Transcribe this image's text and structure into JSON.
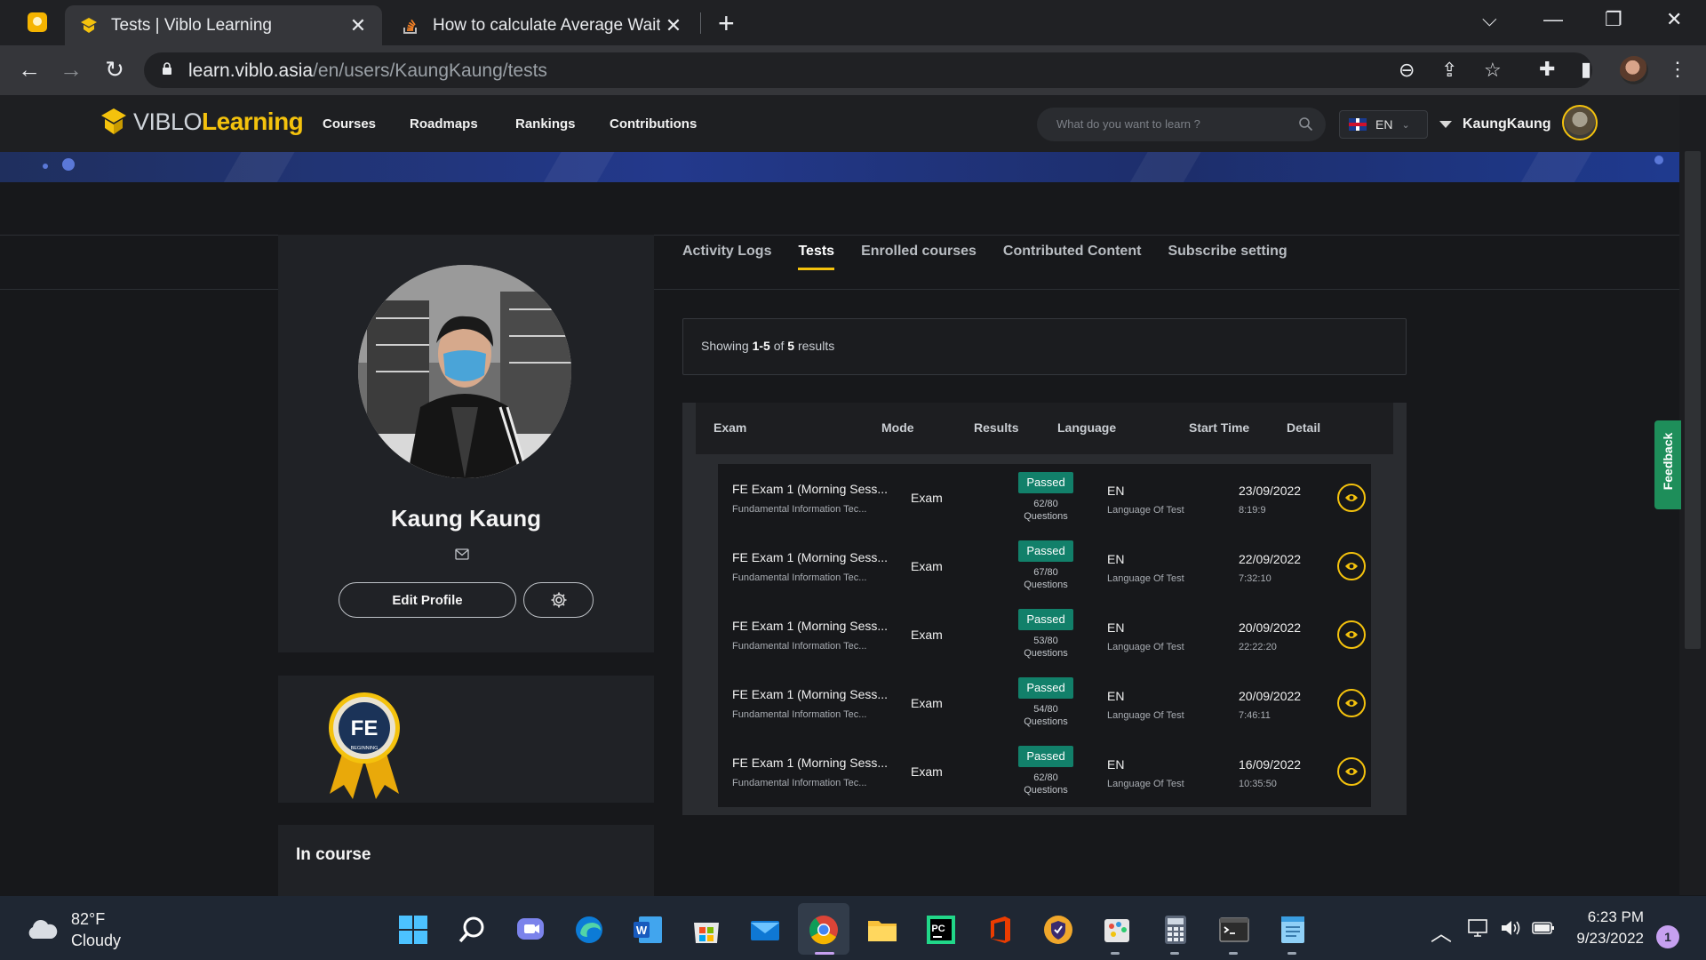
{
  "browser": {
    "tabs": [
      {
        "title": "Tests | Viblo Learning",
        "active": true,
        "favicon": "viblo-logo-icon"
      },
      {
        "title": "How to calculate Average Waiting",
        "active": false,
        "favicon": "stackoverflow-icon"
      }
    ],
    "url_host": "learn.viblo.asia",
    "url_path": "/en/users/KaungKaung/tests"
  },
  "site": {
    "logo_viblo": "VIBLO",
    "logo_learning": "Learning",
    "nav": [
      "Courses",
      "Roadmaps",
      "Rankings",
      "Contributions"
    ],
    "search_placeholder": "What do you want to learn ?",
    "language": "EN",
    "username": "KaungKaung",
    "brand_color": "#f4c20d"
  },
  "profile": {
    "name": "Kaung Kaung",
    "edit_label": "Edit Profile",
    "badge_text": "FE",
    "badge_subtext": "BEGINNING",
    "in_course_title": "In course"
  },
  "profile_tabs": [
    "Activity Logs",
    "Tests",
    "Enrolled courses",
    "Contributed Content",
    "Subscribe setting"
  ],
  "active_tab": "Tests",
  "results": {
    "prefix": "Showing ",
    "range": "1-5",
    "of": " of ",
    "total": "5",
    "suffix": " results"
  },
  "table": {
    "headers": [
      "Exam",
      "Mode",
      "Results",
      "Language",
      "Start Time",
      "Detail"
    ],
    "rows": [
      {
        "exam": "FE Exam 1 (Morning Sess...",
        "course": "Fundamental Information Tec...",
        "mode": "Exam",
        "status": "Passed",
        "score": "62/80",
        "questions_label": "Questions",
        "lang": "EN",
        "lang_label": "Language Of Test",
        "date": "23/09/2022",
        "time": "8:19:9"
      },
      {
        "exam": "FE Exam 1 (Morning Sess...",
        "course": "Fundamental Information Tec...",
        "mode": "Exam",
        "status": "Passed",
        "score": "67/80",
        "questions_label": "Questions",
        "lang": "EN",
        "lang_label": "Language Of Test",
        "date": "22/09/2022",
        "time": "7:32:10"
      },
      {
        "exam": "FE Exam 1 (Morning Sess...",
        "course": "Fundamental Information Tec...",
        "mode": "Exam",
        "status": "Passed",
        "score": "53/80",
        "questions_label": "Questions",
        "lang": "EN",
        "lang_label": "Language Of Test",
        "date": "20/09/2022",
        "time": "22:22:20"
      },
      {
        "exam": "FE Exam 1 (Morning Sess...",
        "course": "Fundamental Information Tec...",
        "mode": "Exam",
        "status": "Passed",
        "score": "54/80",
        "questions_label": "Questions",
        "lang": "EN",
        "lang_label": "Language Of Test",
        "date": "20/09/2022",
        "time": "7:46:11"
      },
      {
        "exam": "FE Exam 1 (Morning Sess...",
        "course": "Fundamental Information Tec...",
        "mode": "Exam",
        "status": "Passed",
        "score": "62/80",
        "questions_label": "Questions",
        "lang": "EN",
        "lang_label": "Language Of Test",
        "date": "16/09/2022",
        "time": "10:35:50"
      }
    ]
  },
  "feedback_label": "Feedback",
  "taskbar": {
    "temperature": "82°F",
    "weather": "Cloudy",
    "time": "6:23 PM",
    "date": "9/23/2022",
    "notification_count": "1"
  }
}
